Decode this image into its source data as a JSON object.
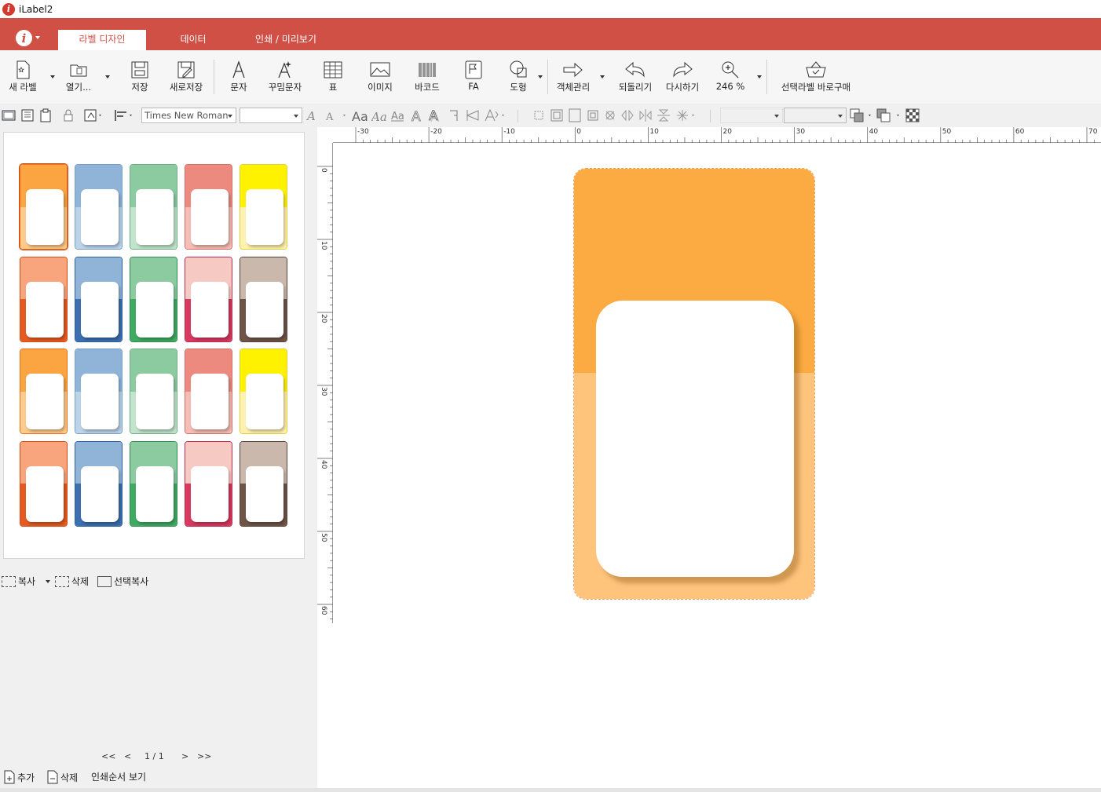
{
  "window": {
    "title": "iLabel2"
  },
  "tabs": [
    {
      "label": "라벨 디자인",
      "active": true
    },
    {
      "label": "데이터",
      "active": false
    },
    {
      "label": "인쇄 / 미리보기",
      "active": false
    }
  ],
  "toolbar": {
    "new_label": "새 라벨",
    "open": "열기...",
    "save": "저장",
    "save_as": "새로저장",
    "text": "문자",
    "fancy_text": "꾸밈문자",
    "table": "표",
    "image": "이미지",
    "barcode": "바코드",
    "fa": "FA",
    "shape": "도형",
    "object_manage": "객체관리",
    "undo": "되돌리기",
    "redo": "다시하기",
    "zoom": "246 %",
    "buy_selected": "선택라벨 바로구매"
  },
  "format": {
    "font_family": "Times New Roman"
  },
  "templates": [
    [
      "#fba442|#ffca8a|#e8731c",
      "#8fb4d8|#bcd4ea|#7b9fc3",
      "#8ccaa0|#c2e4cc|#6fae85",
      "#ec8a80|#f5bdb6|#d06f66",
      "#fff200|#fff2b0|#e0cf3a"
    ],
    [
      "#f8a47c|#e55a20|#d84a16",
      "#8fb4d8|#3b6fb0|#2f5e9c",
      "#8ccaa0|#3faa62|#2e9050",
      "#f6cac2|#d93860|#c02a50",
      "#cbb8ac|#6f5448|#5c4236"
    ],
    [
      "#fba442|#ffca8a|#e8731c",
      "#8fb4d8|#bcd4ea|#7b9fc3",
      "#8ccaa0|#c2e4cc|#6fae85",
      "#ec8a80|#f5bdb6|#d06f66",
      "#fff200|#fff2b0|#e0cf3a"
    ],
    [
      "#f8a47c|#e55a20|#d84a16",
      "#8fb4d8|#3b6fb0|#2f5e9c",
      "#8ccaa0|#3faa62|#2e9050",
      "#f6cac2|#d93860|#c02a50",
      "#cbb8ac|#6f5448|#5c4236"
    ]
  ],
  "panel_actions": {
    "copy": "복사",
    "delete": "삭제",
    "select_copy": "선택복사"
  },
  "pager": {
    "first": "<<",
    "prev": "<",
    "page": "1 / 1",
    "next": ">",
    "last": ">>"
  },
  "bottom_actions": {
    "add": "추가",
    "delete": "삭제",
    "print_order": "인쇄순서 보기"
  },
  "ruler": {
    "h_labels": [
      "-30",
      "-20",
      "-10",
      "0",
      "10",
      "20",
      "30",
      "40",
      "50",
      "60",
      "70"
    ],
    "v_labels": [
      "0",
      "10",
      "20",
      "30",
      "40",
      "50",
      "60"
    ]
  },
  "colors": {
    "accent": "#d15046",
    "label_top": "#fbab42",
    "label_bottom": "#ffc47c"
  }
}
